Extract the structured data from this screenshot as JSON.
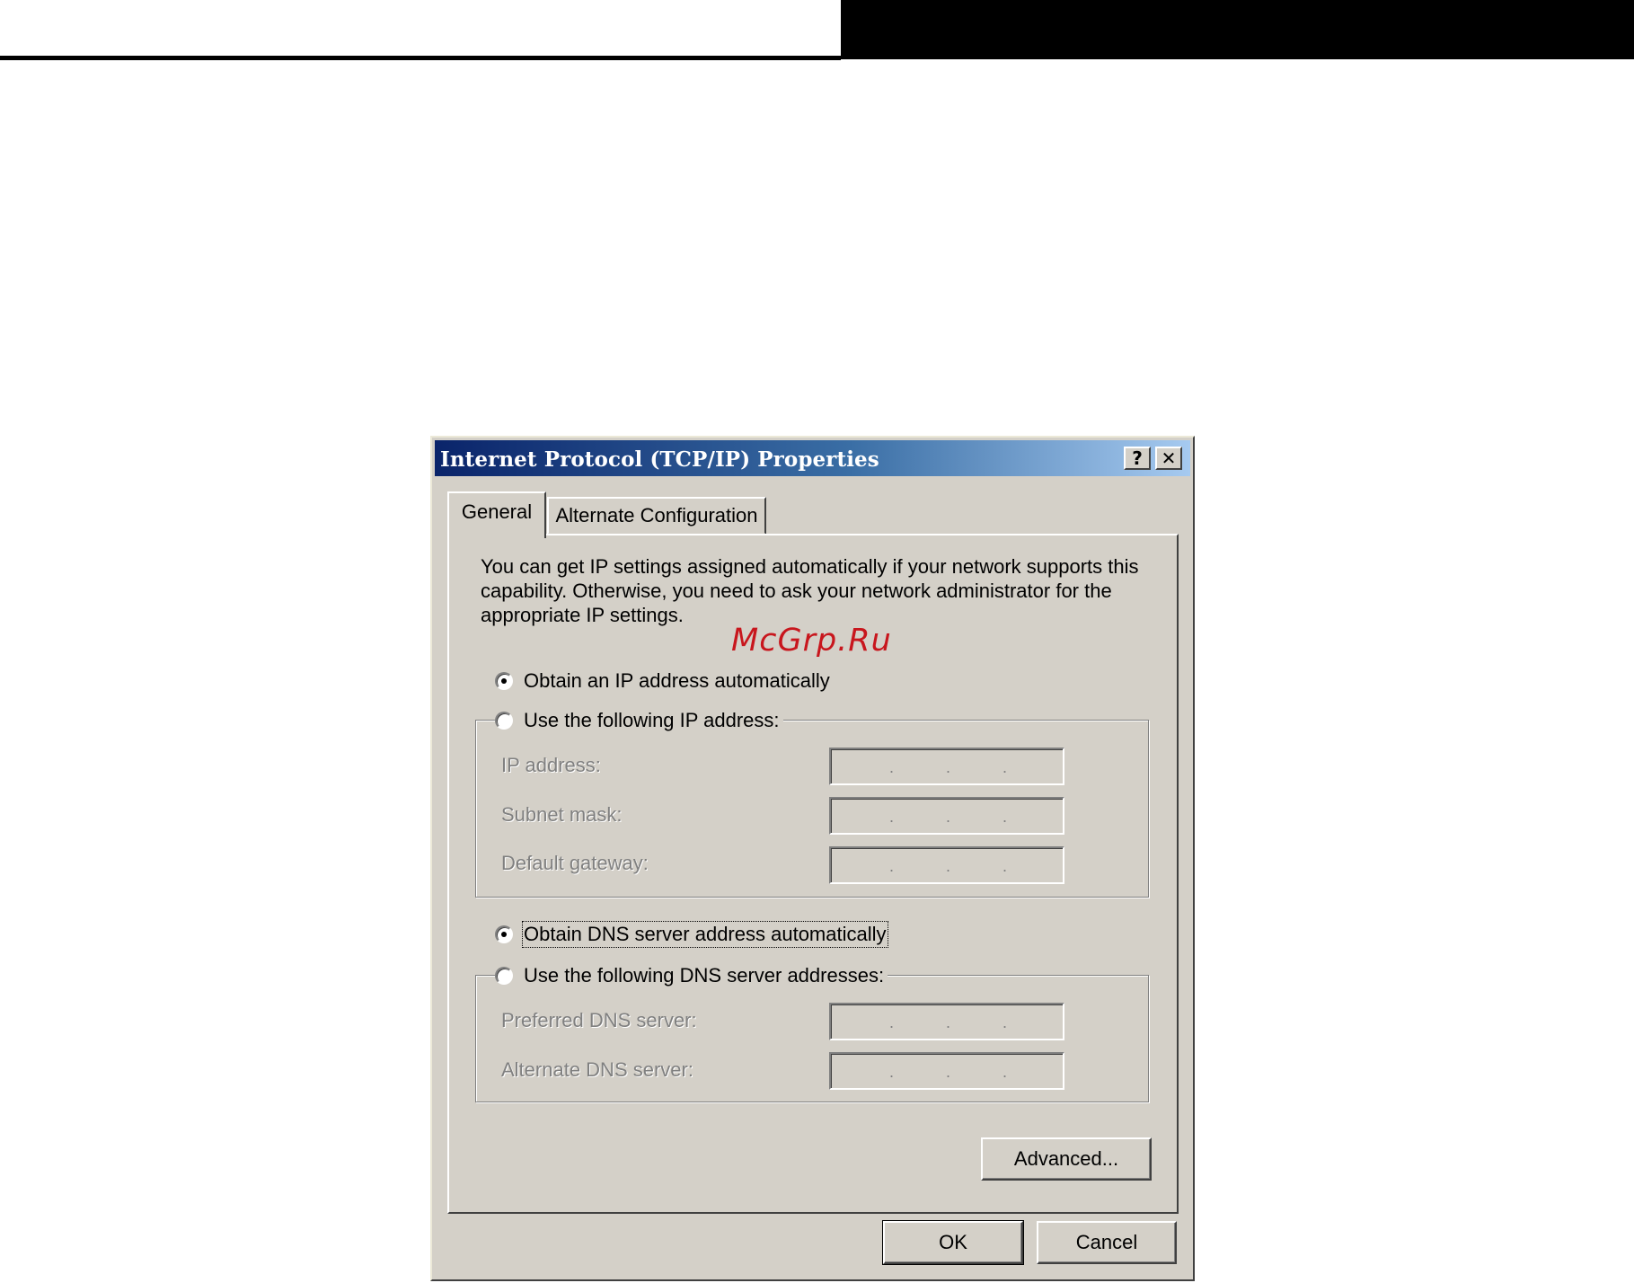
{
  "dialog": {
    "title": "Internet Protocol (TCP/IP) Properties",
    "help_button": "?",
    "close_button": "✕"
  },
  "tabs": [
    {
      "label": "General",
      "active": true
    },
    {
      "label": "Alternate Configuration",
      "active": false
    }
  ],
  "general": {
    "intro": "You can get IP settings assigned automatically if your network supports this capability. Otherwise, you need to ask your network administrator for the appropriate IP settings.",
    "ip_auto_label": "Obtain an IP address automatically",
    "ip_auto_selected": true,
    "ip_manual_label": "Use the following IP address:",
    "ip_manual_selected": false,
    "ip_fields": [
      {
        "label": "IP address:",
        "value": ". . ."
      },
      {
        "label": "Subnet mask:",
        "value": ". . ."
      },
      {
        "label": "Default gateway:",
        "value": ". . ."
      }
    ],
    "dns_auto_label": "Obtain DNS server address automatically",
    "dns_auto_selected": true,
    "dns_manual_label": "Use the following DNS server addresses:",
    "dns_manual_selected": false,
    "dns_fields": [
      {
        "label": "Preferred DNS server:",
        "value": ". . ."
      },
      {
        "label": "Alternate DNS server:",
        "value": ". . ."
      }
    ],
    "advanced_button": "Advanced..."
  },
  "footer": {
    "ok_button": "OK",
    "cancel_button": "Cancel"
  },
  "watermark": "McGrp.Ru",
  "colors": {
    "dialog_face": "#d4d0c8",
    "title_gradient_start": "#0a246a",
    "title_gradient_end": "#a6caf0",
    "disabled_text": "#808080",
    "watermark": "#c8161d"
  }
}
